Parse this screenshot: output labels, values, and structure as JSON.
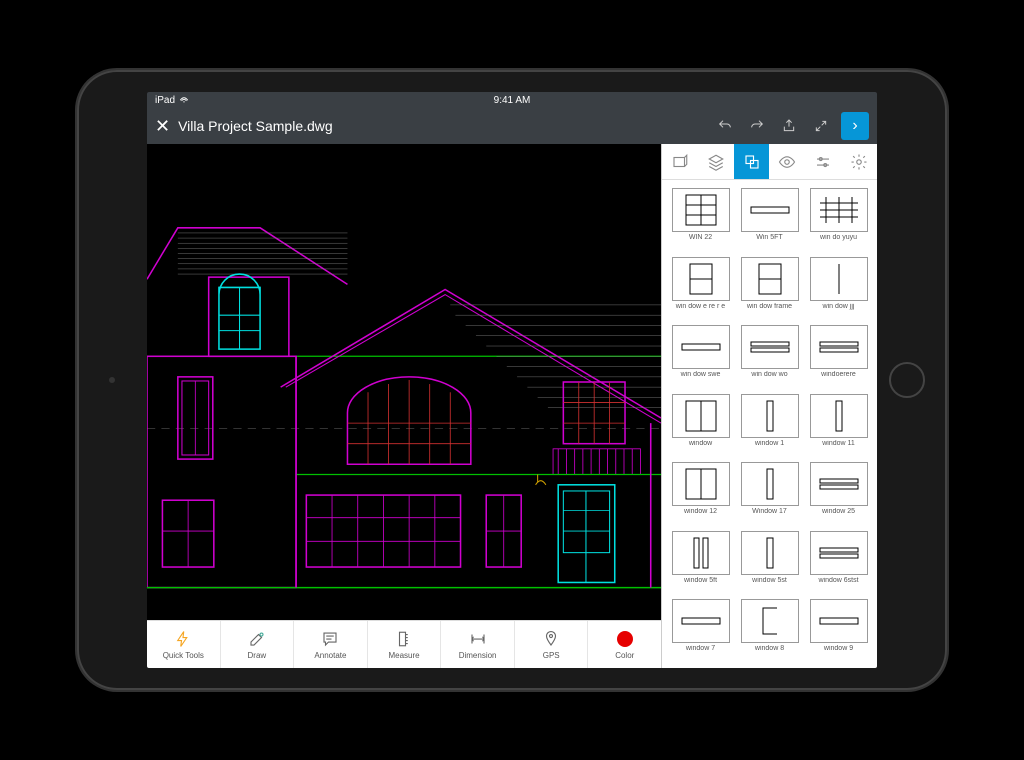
{
  "status_bar": {
    "carrier": "iPad",
    "time": "9:41 AM",
    "wifi": "wifi"
  },
  "header": {
    "file_title": "Villa Project Sample.dwg",
    "icons": {
      "close": "close",
      "undo": "undo",
      "redo": "redo",
      "share": "share",
      "expand": "expand",
      "chevron": "chevron"
    }
  },
  "panel_tabs": [
    {
      "name": "model-tab",
      "active": false
    },
    {
      "name": "layers-tab",
      "active": false
    },
    {
      "name": "blocks-tab",
      "active": true
    },
    {
      "name": "visibility-tab",
      "active": false
    },
    {
      "name": "settings1-tab",
      "active": false
    },
    {
      "name": "settings2-tab",
      "active": false
    }
  ],
  "toolbar": [
    {
      "name": "quick-tools",
      "label": "Quick Tools",
      "icon": "lightning"
    },
    {
      "name": "draw",
      "label": "Draw",
      "icon": "pencil"
    },
    {
      "name": "annotate",
      "label": "Annotate",
      "icon": "comment"
    },
    {
      "name": "measure",
      "label": "Measure",
      "icon": "ruler"
    },
    {
      "name": "dimension",
      "label": "Dimension",
      "icon": "dimension"
    },
    {
      "name": "gps",
      "label": "GPS",
      "icon": "pin"
    },
    {
      "name": "color",
      "label": "Color",
      "icon": "color-dot"
    }
  ],
  "blocks": [
    {
      "label": "WIN 22",
      "shape": "grid6"
    },
    {
      "label": "Win 5FT",
      "shape": "hbar"
    },
    {
      "label": "win do yuyu",
      "shape": "grid9"
    },
    {
      "label": "win dow e re r e",
      "shape": "split2h"
    },
    {
      "label": "win dow frame",
      "shape": "split2h"
    },
    {
      "label": "win dow jjj",
      "shape": "vline"
    },
    {
      "label": "win dow swe",
      "shape": "hbar"
    },
    {
      "label": "win dow wo",
      "shape": "hbar2"
    },
    {
      "label": "windoerere",
      "shape": "hbar2"
    },
    {
      "label": "window",
      "shape": "split2v"
    },
    {
      "label": "window 1",
      "shape": "vbar"
    },
    {
      "label": "window 11",
      "shape": "vbar"
    },
    {
      "label": "window 12",
      "shape": "split2v"
    },
    {
      "label": "Window 17",
      "shape": "vbar"
    },
    {
      "label": "window 25",
      "shape": "hbar2"
    },
    {
      "label": "window 5ft",
      "shape": "vbar2"
    },
    {
      "label": "window 5st",
      "shape": "vbar"
    },
    {
      "label": "window 6stst",
      "shape": "hbar2"
    },
    {
      "label": "window 7",
      "shape": "hbar"
    },
    {
      "label": "window 8",
      "shape": "cshape"
    },
    {
      "label": "window 9",
      "shape": "hbar"
    }
  ],
  "colors": {
    "accent": "#0696d7",
    "color_tool": "#e60000"
  }
}
